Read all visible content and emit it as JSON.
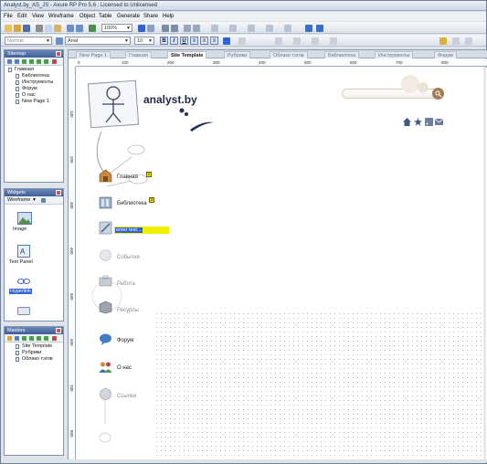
{
  "window": {
    "title": "Analyst.by_AS_JS - Axure RP Pro 5.6 : Licensed to Unlicensed"
  },
  "menu": [
    "File",
    "Edit",
    "View",
    "Wireframe",
    "Object",
    "Table",
    "Generate",
    "Share",
    "Help"
  ],
  "toolbar": {
    "zoom": "100%",
    "style": "Normal",
    "font": "Arial",
    "font_size": "10"
  },
  "panels": {
    "sitemap": {
      "title": "Sitemap",
      "items": [
        {
          "label": "Главная",
          "level": 0
        },
        {
          "label": "Библиотека",
          "level": 1
        },
        {
          "label": "Инструменты",
          "level": 1
        },
        {
          "label": "Форум",
          "level": 1
        },
        {
          "label": "О нас",
          "level": 1
        },
        {
          "label": "New Page 1",
          "level": 1
        }
      ]
    },
    "widgets": {
      "title": "Widgets",
      "library": "Wireframe",
      "items": [
        "Image",
        "Text Panel",
        "Hyperlink"
      ]
    },
    "masters": {
      "title": "Masters",
      "items": [
        "Site Template",
        "Рубрики",
        "Облако тэгов"
      ]
    }
  },
  "tabs": [
    {
      "label": "New Page 1",
      "active": false
    },
    {
      "label": "Главная",
      "active": false
    },
    {
      "label": "Site Template",
      "active": true
    },
    {
      "label": "Рубрики",
      "active": false
    },
    {
      "label": "Облако тэгов",
      "active": false
    },
    {
      "label": "Библиотека",
      "active": false
    },
    {
      "label": "Инструменты",
      "active": false
    },
    {
      "label": "Форум",
      "active": false
    }
  ],
  "ruler": {
    "h": [
      "0",
      "100",
      "200",
      "300",
      "400",
      "500",
      "600",
      "700",
      "800"
    ],
    "v": [
      "100",
      "200",
      "300",
      "400",
      "500",
      "600",
      "700",
      "800"
    ]
  },
  "design": {
    "logo": "analyst.by",
    "text_field": "enter text...",
    "nav": [
      {
        "label": "Главная",
        "badge": "1",
        "faded": false
      },
      {
        "label": "Библиотека",
        "badge": "2",
        "faded": false
      },
      {
        "label": "События",
        "faded": true
      },
      {
        "label": "Работа",
        "faded": true
      },
      {
        "label": "Ресурсы",
        "faded": true
      },
      {
        "label": "Форум",
        "faded": false
      },
      {
        "label": "О нас",
        "faded": false
      },
      {
        "label": "Ссылки",
        "faded": true
      }
    ]
  },
  "colors": {
    "titlebar": "#cfd7e3",
    "panel_head": "#3f5f98",
    "highlight": "#f1f000",
    "search": "#a57b52"
  }
}
